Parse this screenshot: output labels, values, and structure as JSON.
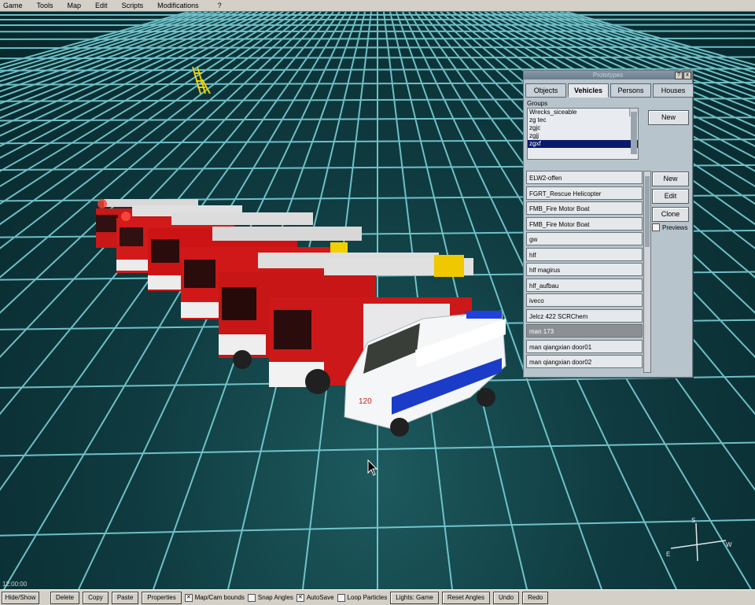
{
  "menu": [
    "Game",
    "Tools",
    "Map",
    "Edit",
    "Scripts",
    "Modifications",
    "?"
  ],
  "panel": {
    "title": "Prototypes",
    "title_buttons": [
      "?",
      "x"
    ],
    "tabs": [
      "Objects",
      "Vehicles",
      "Persons",
      "Houses"
    ],
    "active_tab": "Vehicles",
    "groups_label": "Groups",
    "groups": [
      "Wrecks_siceable",
      "zg tec",
      "zgjc",
      "zgjj",
      "zgxf"
    ],
    "groups_selected": "zgxf",
    "groups_new": "New",
    "items": [
      "ELW2-offen",
      "FGRT_Rescue Helicopter",
      "FMB_Fire Motor Boat",
      "FMB_Fire Motor Boat",
      "gw",
      "hlf",
      "hlf magirus",
      "hlf_aufbau",
      "iveco",
      "Jelcz 422 SCRChem",
      "man 173",
      "man qiangxian door01",
      "man qiangxian door02"
    ],
    "items_selected": "man 173",
    "buttons": {
      "new": "New",
      "edit": "Edit",
      "clone": "Clone"
    },
    "previews_label": "Previews",
    "previews_checked": false
  },
  "viewport": {
    "clock": "12:00:00",
    "vehicles": [
      "fire-truck",
      "fire-truck",
      "fire-truck",
      "fire-truck",
      "fire-truck",
      "fire-truck",
      "ambulance"
    ],
    "compass": {
      "n": "S",
      "e": "E",
      "w": "W"
    }
  },
  "statusbar": {
    "hide_show": "Hide/Show",
    "delete": "Delete",
    "copy": "Copy",
    "paste": "Paste",
    "properties": "Properties",
    "map_cam_bounds": "Map/Cam bounds",
    "map_cam_checked": true,
    "snap_angles": "Snap Angles",
    "snap_checked": false,
    "autosave": "AutoSave",
    "autosave_checked": true,
    "loop_particles": "Loop Particles",
    "loop_checked": false,
    "lights": "Lights: Game",
    "reset_angles": "Reset Angles",
    "undo": "Undo",
    "redo": "Redo"
  },
  "colors": {
    "grid": "#7fd8e0",
    "floor": "#0f3b40",
    "panel": "#b8c4cc",
    "fire_red": "#c81818",
    "ambulance_blue": "#1a3cc8"
  }
}
